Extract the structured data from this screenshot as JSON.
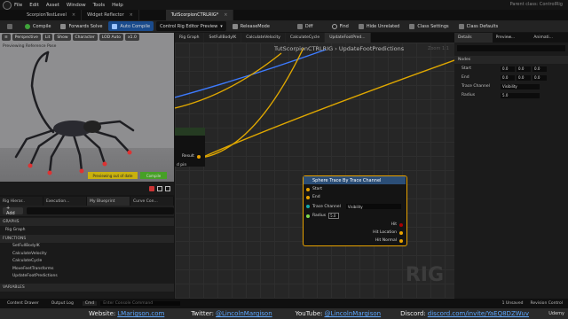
{
  "menu": {
    "items": [
      "File",
      "Edit",
      "Asset",
      "Window",
      "Tools",
      "Help"
    ],
    "project": "Parent class: ControlRig"
  },
  "doc_tabs": [
    "ScorpionTestLevel",
    "Widget Reflector",
    "TutScorpionCTRLRIG*"
  ],
  "toolbar": {
    "compile": "Compile",
    "forwards_solve": "Forwards Solve",
    "auto_compile": "Auto Compile",
    "preview": "Control Rig Editor Preview",
    "release_mode": "ReleaseMode",
    "diff": "Diff",
    "find": "Find",
    "hide_unrelated": "Hide Unrelated",
    "class_settings": "Class Settings",
    "class_defaults": "Class Defaults"
  },
  "viewport": {
    "perspective": "Perspective",
    "lit": "Lit",
    "show": "Show",
    "character": "Character",
    "lod": "LOD Auto",
    "speed": "x1.0",
    "previewing": "Previewing Reference Pose",
    "warning": "Previewing out of date",
    "compile_label": "Compile"
  },
  "left_tabs": [
    "Rig Hierar..",
    "Execution...",
    "My Blueprint",
    "Curve Con..."
  ],
  "left": {
    "add": "+ Add",
    "sections": [
      "GRAPHS",
      "FUNCTIONS",
      "VARIABLES"
    ],
    "graph": "Rig Graph",
    "functions": [
      "SetFullBodyIK",
      "CalculateVelocity",
      "CalculateCycle",
      "MoveFeetTransforms",
      "UpdateFootPredictions"
    ]
  },
  "graph_tabs": [
    "Rig Graph",
    "SetFullBodyIK",
    "CalculateVelocity",
    "CalculateCycle",
    "UpdateFootPred..."
  ],
  "graph": {
    "breadcrumb": "TutScorpionCTRLRIG  ›  UpdateFootPredictions",
    "zoom": "Zoom 1:1",
    "watermark": "RIG",
    "result": "Result",
    "pin_text": "d pin"
  },
  "node": {
    "title": "Sphere Trace By Trace Channel",
    "start": "Start",
    "end": "End",
    "trace_channel": "Trace Channel",
    "channel_value": "Visibility",
    "radius": "Radius",
    "radius_value": "5.0",
    "hit": "Hit",
    "hit_location": "Hit Location",
    "hit_normal": "Hit Normal"
  },
  "details": {
    "tabs": [
      "Details",
      "Preview...",
      "Animati..."
    ],
    "section": "Nodes",
    "start": "Start",
    "end": "End",
    "trace_channel": "Trace Channel",
    "radius": "Radius",
    "vals": [
      "0.0",
      "0.0",
      "0.0"
    ],
    "channel_value": "Visibility",
    "radius_value": "5.0"
  },
  "status": {
    "content_drawer": "Content Drawer",
    "output_log": "Output Log",
    "cmd": "Cmd",
    "console": "Enter Console Command",
    "unsaved": "1 Unsaved",
    "revision": "Revision Control"
  },
  "footer": {
    "website_label": "Website:",
    "website": "LMarigson.com",
    "twitter_label": "Twitter:",
    "twitter": "@LincolnMargison",
    "youtube_label": "YouTube:",
    "youtube": "@LincolnMargison",
    "discord_label": "Discord:",
    "discord": "discord.com/invite/YaEQ8DZWuv",
    "udemy": "Udemy"
  },
  "colors": {
    "accent": "#e8a200",
    "node_header": "#2b4e77",
    "compile_green": "#46a026",
    "warn_yellow": "#c9b10e"
  }
}
